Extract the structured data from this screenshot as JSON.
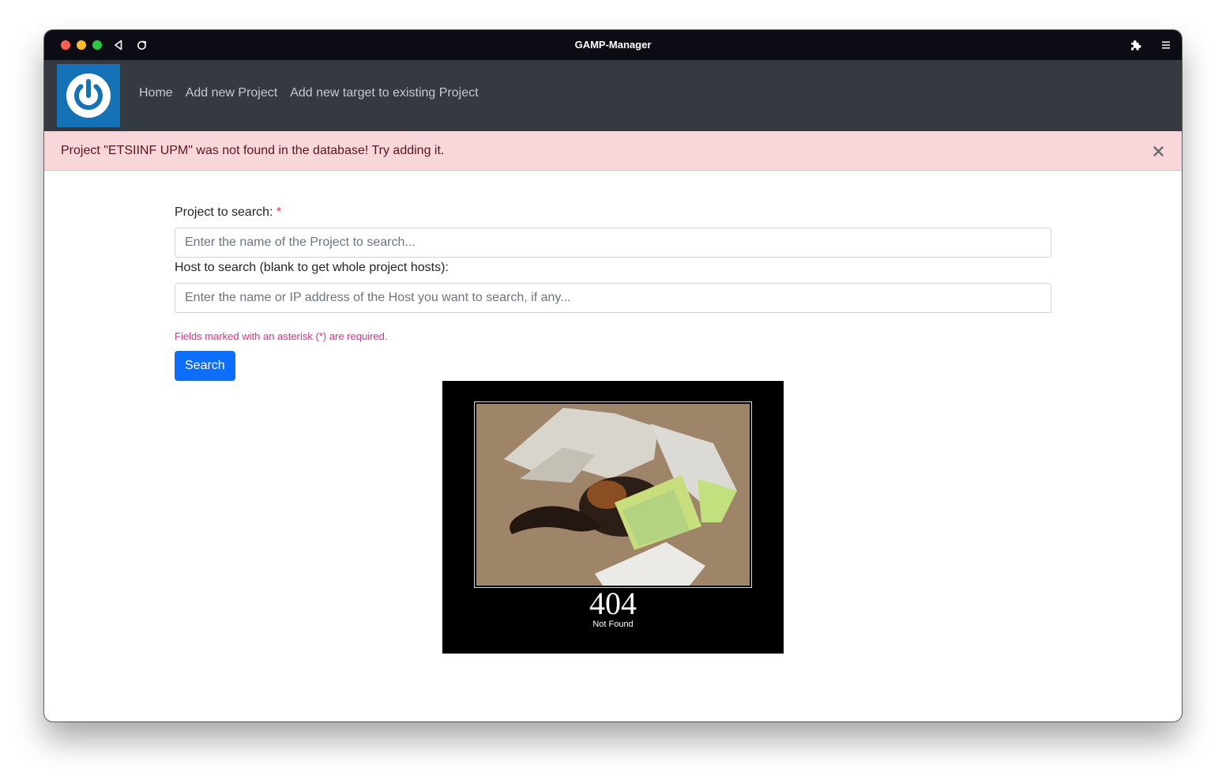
{
  "browser": {
    "title": "GAMP-Manager",
    "icons": [
      "close-dot",
      "minimize-dot",
      "zoom-dot",
      "back-icon",
      "reload-icon",
      "extensions-icon",
      "menu-icon"
    ]
  },
  "navbar": {
    "logo_icon": "power-icon",
    "links": [
      {
        "label": "Home"
      },
      {
        "label": "Add new Project"
      },
      {
        "label": "Add new target to existing Project"
      }
    ]
  },
  "alert": {
    "message": "Project \"ETSIINF UPM\" was not found in the database! Try adding it.",
    "close_icon": "close-icon"
  },
  "form": {
    "project_label": "Project to search:",
    "required_mark": "*",
    "project_placeholder": "Enter the name of the Project to search...",
    "project_value": "",
    "host_label": "Host to search (blank to get whole project hosts):",
    "host_placeholder": "Enter the name or IP address of the Host you want to search, if any...",
    "host_value": "",
    "required_note": "Fields marked with an asterisk (*) are required.",
    "search_label": "Search"
  },
  "not_found": {
    "code": "404",
    "text": "Not Found"
  },
  "colors": {
    "navbar": "#343a40",
    "alert_bg": "#f8d7da",
    "alert_text": "#58151c",
    "primary": "#0d6efd",
    "required": "#dc3545",
    "note": "#d63384",
    "logo_bg": "#1572b6"
  }
}
